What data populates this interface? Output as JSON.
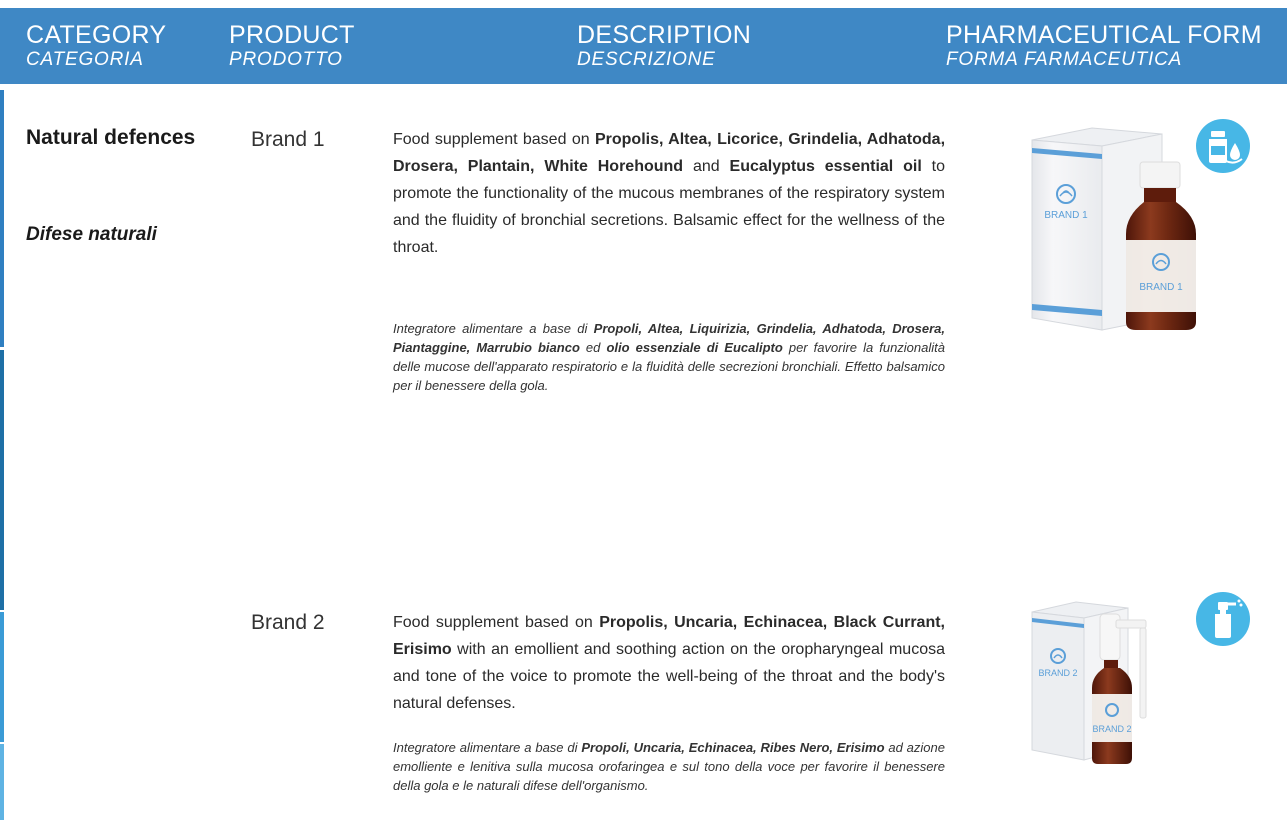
{
  "header": {
    "columns": [
      {
        "en": "CATEGORY",
        "it": "CATEGORIA"
      },
      {
        "en": "PRODUCT",
        "it": "PRODOTTO"
      },
      {
        "en": "DESCRIPTION",
        "it": "DESCRIZIONE"
      },
      {
        "en": "PHARMACEUTICAL FORM",
        "it": "FORMA FARMACEUTICA"
      }
    ]
  },
  "category": {
    "en": "Natural defences",
    "it": "Difese naturali"
  },
  "products": [
    {
      "brand": "Brand 1",
      "desc_en": [
        {
          "t": "Food supplement based on "
        },
        {
          "t": "Propolis, Altea, Licorice, Grindelia, Adhatoda, Drosera, Plantain, White Horehound",
          "b": true
        },
        {
          "t": " and "
        },
        {
          "t": "Eucalyp­tus essential oil",
          "b": true
        },
        {
          "t": " to promote the functionality of the mucous membranes of the respiratory system and the fluidity of bronchial secretions. Balsamic effect for the wellness of the throat."
        }
      ],
      "desc_it": [
        {
          "t": "Integratore alimentare a base di "
        },
        {
          "t": "Propoli, Altea, Liquirizia, Grindelia, Adhatoda, Drosera, Piantaggine, Marrubio bianco",
          "b": true
        },
        {
          "t": " ed "
        },
        {
          "t": "olio essenziale di Eucalipto",
          "b": true
        },
        {
          "t": " per favorire la funzionalità delle mucose dell'apparato respiratorio e la fluidità delle secrezioni bronchiali. Effetto balsamico per il benessere della gola."
        }
      ],
      "box_label": "BRAND 1",
      "bottle_label": "BRAND 1",
      "form_icon": "syrup-bottle-drop-icon"
    },
    {
      "brand": "Brand 2",
      "desc_en": [
        {
          "t": "Food supplement based on "
        },
        {
          "t": "Propolis, Uncaria, Echinacea, Black Currant, Erisimo",
          "b": true
        },
        {
          "t": " with an emollient and soothing action on the oropharyngeal mucosa and tone of the voice to promote the well-being of the throat and the body's natural defenses."
        }
      ],
      "desc_it": [
        {
          "t": "Integratore alimentare a base di "
        },
        {
          "t": "Propoli, Uncaria, Echinacea, Ribes Nero, Erisimo",
          "b": true
        },
        {
          "t": " ad azione emolliente e lenitiva sulla mucosa orofarin­gea e sul tono della voce per favorire il benessere della gola e le naturali difese dell'organismo."
        }
      ],
      "box_label": "BRAND 2",
      "bottle_label": "BRAND 2",
      "form_icon": "spray-bottle-icon"
    }
  ],
  "colors": {
    "header_bg": "#3f88c5",
    "icon_bg": "#47b7e6",
    "box_stripe": "#5b9fd8",
    "bottle_amber": "#7a2a14"
  }
}
